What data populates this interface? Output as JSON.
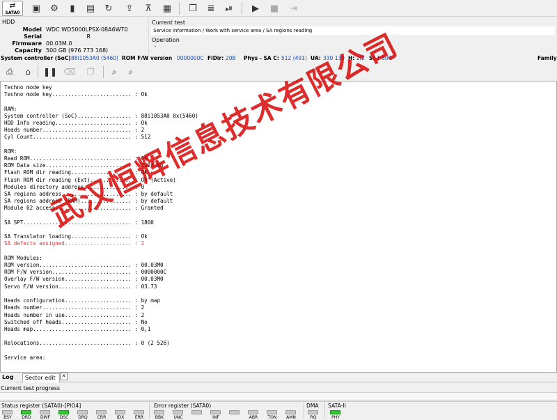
{
  "toolbar": {
    "sata_label": "SATA0",
    "icons": [
      "save-icon",
      "settings-icon",
      "chip-icon",
      "drive-icon",
      "reload-icon",
      "export-icon",
      "parking-icon",
      "grid-icon",
      "copy-icon",
      "stack-icon",
      "step-icon",
      "play-icon",
      "stop-icon",
      "log-icon"
    ]
  },
  "hdd": {
    "section_title": "HDD",
    "rows": [
      {
        "key": "Model",
        "value": "WDC WD5000LPSX-08A6WT0"
      },
      {
        "key": "Serial",
        "value": "                       R"
      },
      {
        "key": "Firmware",
        "value": "00.03M.0"
      },
      {
        "key": "Capacity",
        "value": "500 GB (976 773 168)"
      }
    ]
  },
  "current_test": {
    "label": "Current test",
    "value": "Service information / Work with service area / SA regions reading"
  },
  "operation": {
    "label": "Operation",
    "value": "-"
  },
  "status_line": {
    "soc_label": "System controller (SoC)",
    "soc_value": "88i1053A0 (5460)",
    "rom_label": "ROM F/W version",
    "rom_value": "0000000C",
    "fldir_label": "FlDir:",
    "fldir_value": "20B",
    "phys_label": "Phys - SA C:",
    "phys_value": "512 (491)",
    "ua_label": "UA:",
    "ua_value": "330 139",
    "h_label": "H:",
    "h_value": "2/2",
    "s_label": "S:",
    "s_value": "1 800",
    "family_label": "Family"
  },
  "log": {
    "lines": [
      {
        "text": "Techno mode key"
      },
      {
        "text": "Techno mode key......................... : Ok"
      },
      {
        "text": ""
      },
      {
        "text": "RAM:"
      },
      {
        "text": "System controller (SoC)................. : 88i1053A0 0x(5460)"
      },
      {
        "text": "HDD Info reading........................ : Ok"
      },
      {
        "text": "Heads number............................ : 2"
      },
      {
        "text": "Cyl Count............................... : 512"
      },
      {
        "text": ""
      },
      {
        "text": "ROM:"
      },
      {
        "text": "Read ROM................................ : Ok"
      },
      {
        "text": "ROM Data size........................... : 1024 Kb"
      },
      {
        "text": "Flash ROM dir reading................... : Ok"
      },
      {
        "text": "Flash ROM dir reading (Ext)............. : Ok (Active)"
      },
      {
        "text": "Modules directory address............... : 0"
      },
      {
        "text": "SA regions address...................... : by default"
      },
      {
        "text": "SA regions address (RAM)................ : by default"
      },
      {
        "text": "Module 02 access........................ : Granted"
      },
      {
        "text": ""
      },
      {
        "text": "SA SPT.................................. : 1800"
      },
      {
        "text": ""
      },
      {
        "text": "SA Translator loading................... : Ok"
      },
      {
        "text": "SA defects assigned..................... : 2",
        "red": true
      },
      {
        "text": ""
      },
      {
        "text": "ROM Modules:"
      },
      {
        "text": "ROM version............................. : 00.03M0"
      },
      {
        "text": "ROM F/W version......................... : 0000000C"
      },
      {
        "text": "Overlay F/W version..................... : 00.03M0"
      },
      {
        "text": "Servo F/W version....................... : 03.73"
      },
      {
        "text": ""
      },
      {
        "text": "Heads configuration..................... : by map"
      },
      {
        "text": "Heads number............................ : 2"
      },
      {
        "text": "Heads number in use..................... : 2"
      },
      {
        "text": "Switched off heads...................... : No"
      },
      {
        "text": "Heads map............................... : 0,1"
      },
      {
        "text": ""
      },
      {
        "text": "Relocations............................. : 0 (2 526)"
      },
      {
        "text": ""
      },
      {
        "text": "Service area:"
      }
    ]
  },
  "watermark": "武汉恒辉信息技术有限公司",
  "tabs": [
    {
      "label": "Log"
    },
    {
      "label": "Sector edit"
    }
  ],
  "progress": {
    "label": "Current test progress",
    "value": 0
  },
  "registers": {
    "status_title": "Status register (SATA0)-[PIO4]",
    "status_leds": [
      {
        "label": "BSY",
        "on": false
      },
      {
        "label": "DRD",
        "on": true
      },
      {
        "label": "DWF",
        "on": false
      },
      {
        "label": "DSC",
        "on": true
      },
      {
        "label": "DRQ",
        "on": false
      },
      {
        "label": "CRR",
        "on": false
      },
      {
        "label": "IDX",
        "on": false
      },
      {
        "label": "ERR",
        "on": false
      }
    ],
    "error_title": "Error register (SATA0)",
    "error_leds": [
      {
        "label": "BBK",
        "on": false
      },
      {
        "label": "UNC",
        "on": false
      },
      {
        "label": "",
        "on": false
      },
      {
        "label": "INF",
        "on": false
      },
      {
        "label": "",
        "on": false
      },
      {
        "label": "ABR",
        "on": false
      },
      {
        "label": "TON",
        "on": false
      },
      {
        "label": "AMN",
        "on": false
      }
    ],
    "dma_title": "DMA",
    "dma_leds": [
      {
        "label": "RQ",
        "on": false
      }
    ],
    "sata_title": "SATA-II",
    "sata_leds": [
      {
        "label": "PHY",
        "on": true
      }
    ]
  },
  "colors": {
    "accent_blue": "#1a4bb0",
    "log_error_red": "#e23333",
    "led_on": "#2ec82e",
    "led_off": "#c8c8c8",
    "watermark_red": "#d60000"
  }
}
